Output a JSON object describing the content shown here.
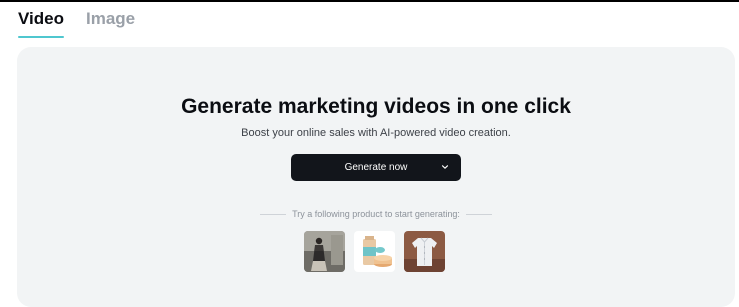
{
  "tabs": [
    {
      "label": "Video",
      "active": true
    },
    {
      "label": "Image",
      "active": false
    }
  ],
  "hero": {
    "title": "Generate marketing videos in one click",
    "subtitle": "Boost your online sales with AI-powered video creation.",
    "button_label": "Generate now",
    "button_icon": "chevron-down-icon"
  },
  "samples": {
    "prompt": "Try a following product to start generating:",
    "items": [
      {
        "name": "fashion-outfit-thumbnail"
      },
      {
        "name": "skincare-jar-thumbnail"
      },
      {
        "name": "white-shirt-thumbnail"
      }
    ]
  },
  "colors": {
    "accent": "#4fc7cf",
    "button_bg": "#12151b",
    "panel_bg": "#f2f4f5"
  }
}
